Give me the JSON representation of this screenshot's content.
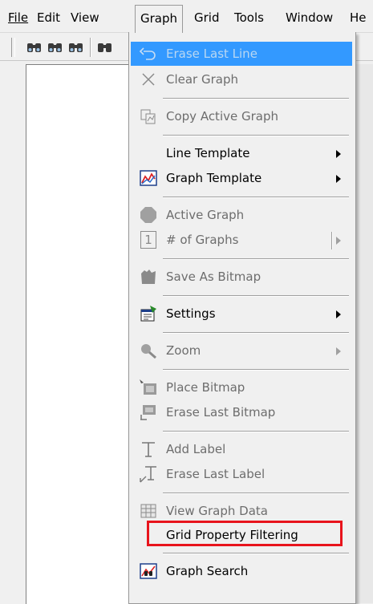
{
  "menubar": {
    "items": [
      {
        "label": "File"
      },
      {
        "label": "Edit"
      },
      {
        "label": "View"
      },
      {
        "label": "Graph"
      },
      {
        "label": "Grid"
      },
      {
        "label": "Tools"
      },
      {
        "label": "Window"
      },
      {
        "label": "He"
      }
    ]
  },
  "graph_menu": {
    "erase_last_line": "Erase Last Line",
    "clear_graph": "Clear Graph",
    "copy_active_graph": "Copy Active Graph",
    "line_template": "Line Template",
    "graph_template": "Graph Template",
    "active_graph": "Active Graph",
    "num_graphs": "# of Graphs",
    "num_graphs_badge": "1",
    "save_as_bitmap": "Save As Bitmap",
    "settings": "Settings",
    "zoom": "Zoom",
    "place_bitmap": "Place Bitmap",
    "erase_last_bitmap": "Erase Last Bitmap",
    "add_label": "Add Label",
    "erase_last_label": "Erase Last Label",
    "view_graph_data": "View Graph Data",
    "grid_property_filtering": "Grid Property Filtering",
    "graph_search": "Graph Search"
  },
  "colors": {
    "highlight": "#3399ff",
    "annotation_box": "#e8141c"
  }
}
